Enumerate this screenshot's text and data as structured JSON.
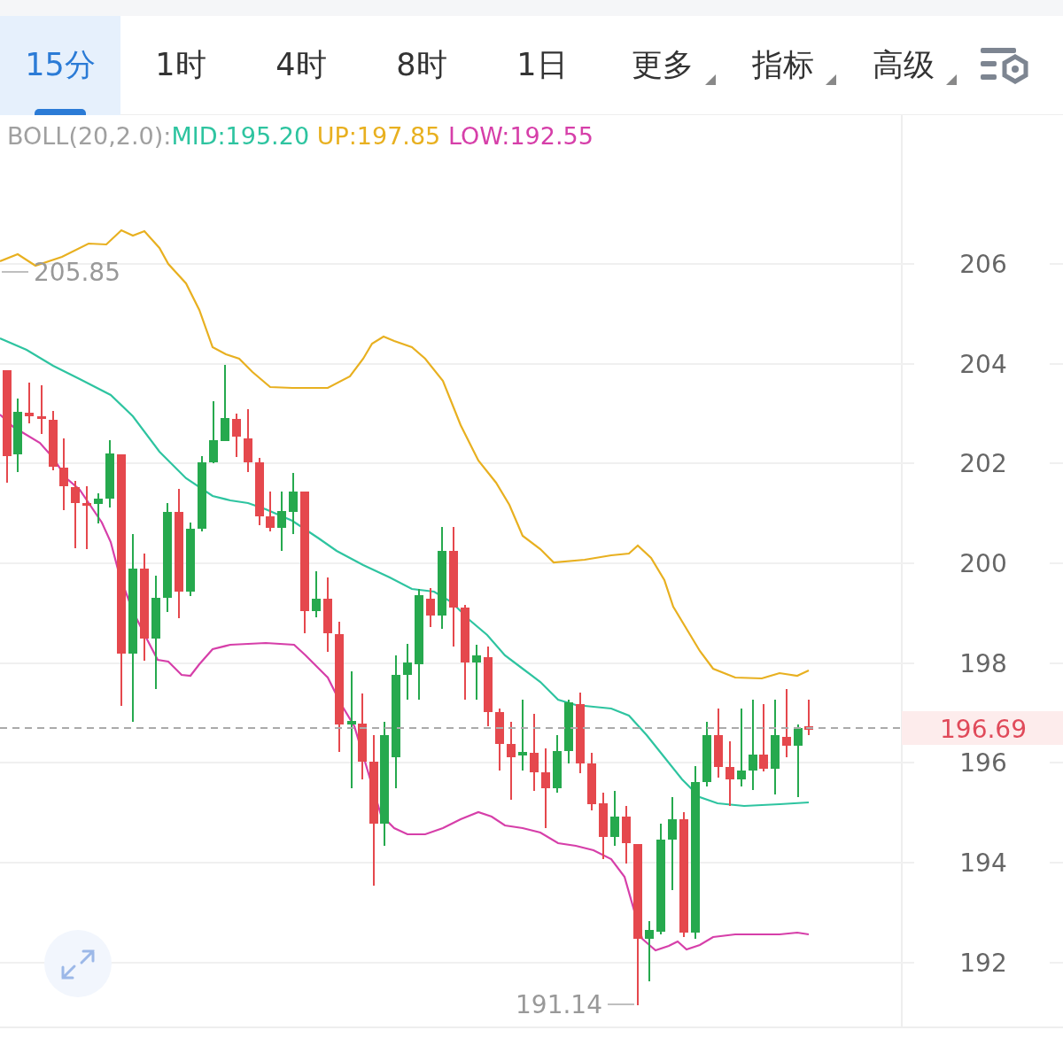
{
  "tabs": [
    {
      "label": "15分",
      "selected": true,
      "kind": "plain"
    },
    {
      "label": "1时",
      "selected": false,
      "kind": "plain"
    },
    {
      "label": "4时",
      "selected": false,
      "kind": "plain"
    },
    {
      "label": "8时",
      "selected": false,
      "kind": "plain"
    },
    {
      "label": "1日",
      "selected": false,
      "kind": "plain"
    },
    {
      "label": "更多",
      "selected": false,
      "kind": "dropdown"
    },
    {
      "label": "指标",
      "selected": false,
      "kind": "dropdown"
    },
    {
      "label": "高级",
      "selected": false,
      "kind": "dropdown"
    }
  ],
  "indicator_legend": {
    "name": "BOLL(20,2.0):",
    "mid": "MID:195.20",
    "up": "UP:197.85",
    "low": "LOW:192.55"
  },
  "chart": {
    "price_axis": [
      "206",
      "204",
      "202",
      "200",
      "198",
      "196",
      "194",
      "192"
    ],
    "current_price": "196.69",
    "high_marker": "205.85",
    "low_marker": "191.14"
  }
}
